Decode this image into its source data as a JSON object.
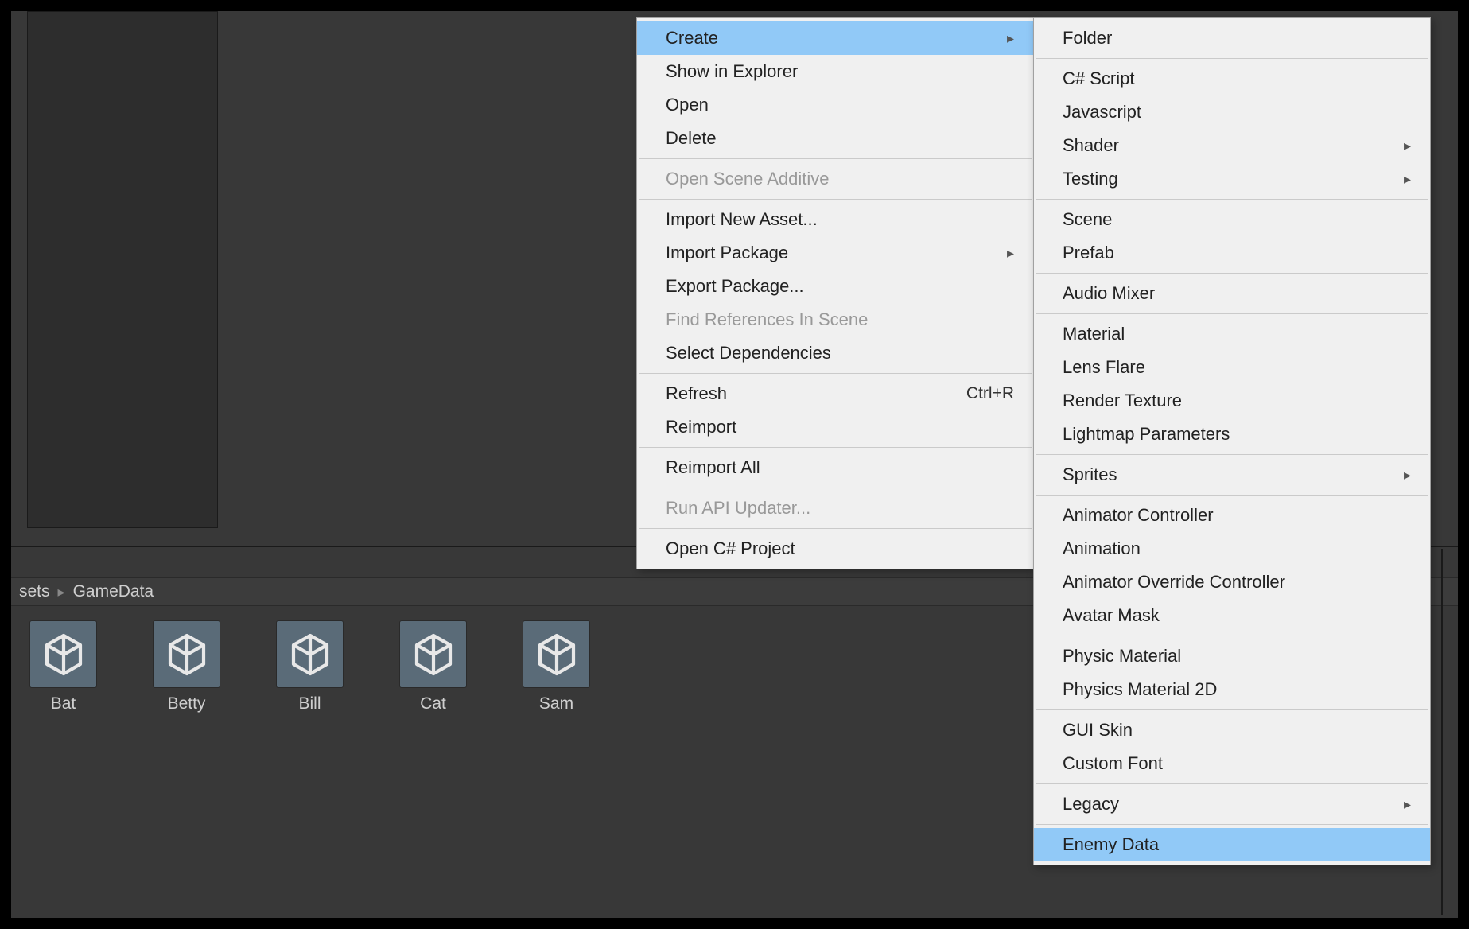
{
  "breadcrumb": {
    "part1": "sets",
    "part2": "GameData"
  },
  "assets": [
    {
      "label": "Bat"
    },
    {
      "label": "Betty"
    },
    {
      "label": "Bill"
    },
    {
      "label": "Cat"
    },
    {
      "label": "Sam"
    }
  ],
  "contextMenu": {
    "create": "Create",
    "showInExplorer": "Show in Explorer",
    "open": "Open",
    "delete": "Delete",
    "openSceneAdditive": "Open Scene Additive",
    "importNewAsset": "Import New Asset...",
    "importPackage": "Import Package",
    "exportPackage": "Export Package...",
    "findReferences": "Find References In Scene",
    "selectDependencies": "Select Dependencies",
    "refresh": "Refresh",
    "refreshShortcut": "Ctrl+R",
    "reimport": "Reimport",
    "reimportAll": "Reimport All",
    "runApiUpdater": "Run API Updater...",
    "openCsProject": "Open C# Project"
  },
  "createMenu": {
    "folder": "Folder",
    "csharpScript": "C# Script",
    "javascript": "Javascript",
    "shader": "Shader",
    "testing": "Testing",
    "scene": "Scene",
    "prefab": "Prefab",
    "audioMixer": "Audio Mixer",
    "material": "Material",
    "lensFlare": "Lens Flare",
    "renderTexture": "Render Texture",
    "lightmapParameters": "Lightmap Parameters",
    "sprites": "Sprites",
    "animatorController": "Animator Controller",
    "animation": "Animation",
    "animatorOverride": "Animator Override Controller",
    "avatarMask": "Avatar Mask",
    "physicMaterial": "Physic Material",
    "physicsMaterial2d": "Physics Material 2D",
    "guiSkin": "GUI Skin",
    "customFont": "Custom Font",
    "legacy": "Legacy",
    "enemyData": "Enemy Data"
  }
}
